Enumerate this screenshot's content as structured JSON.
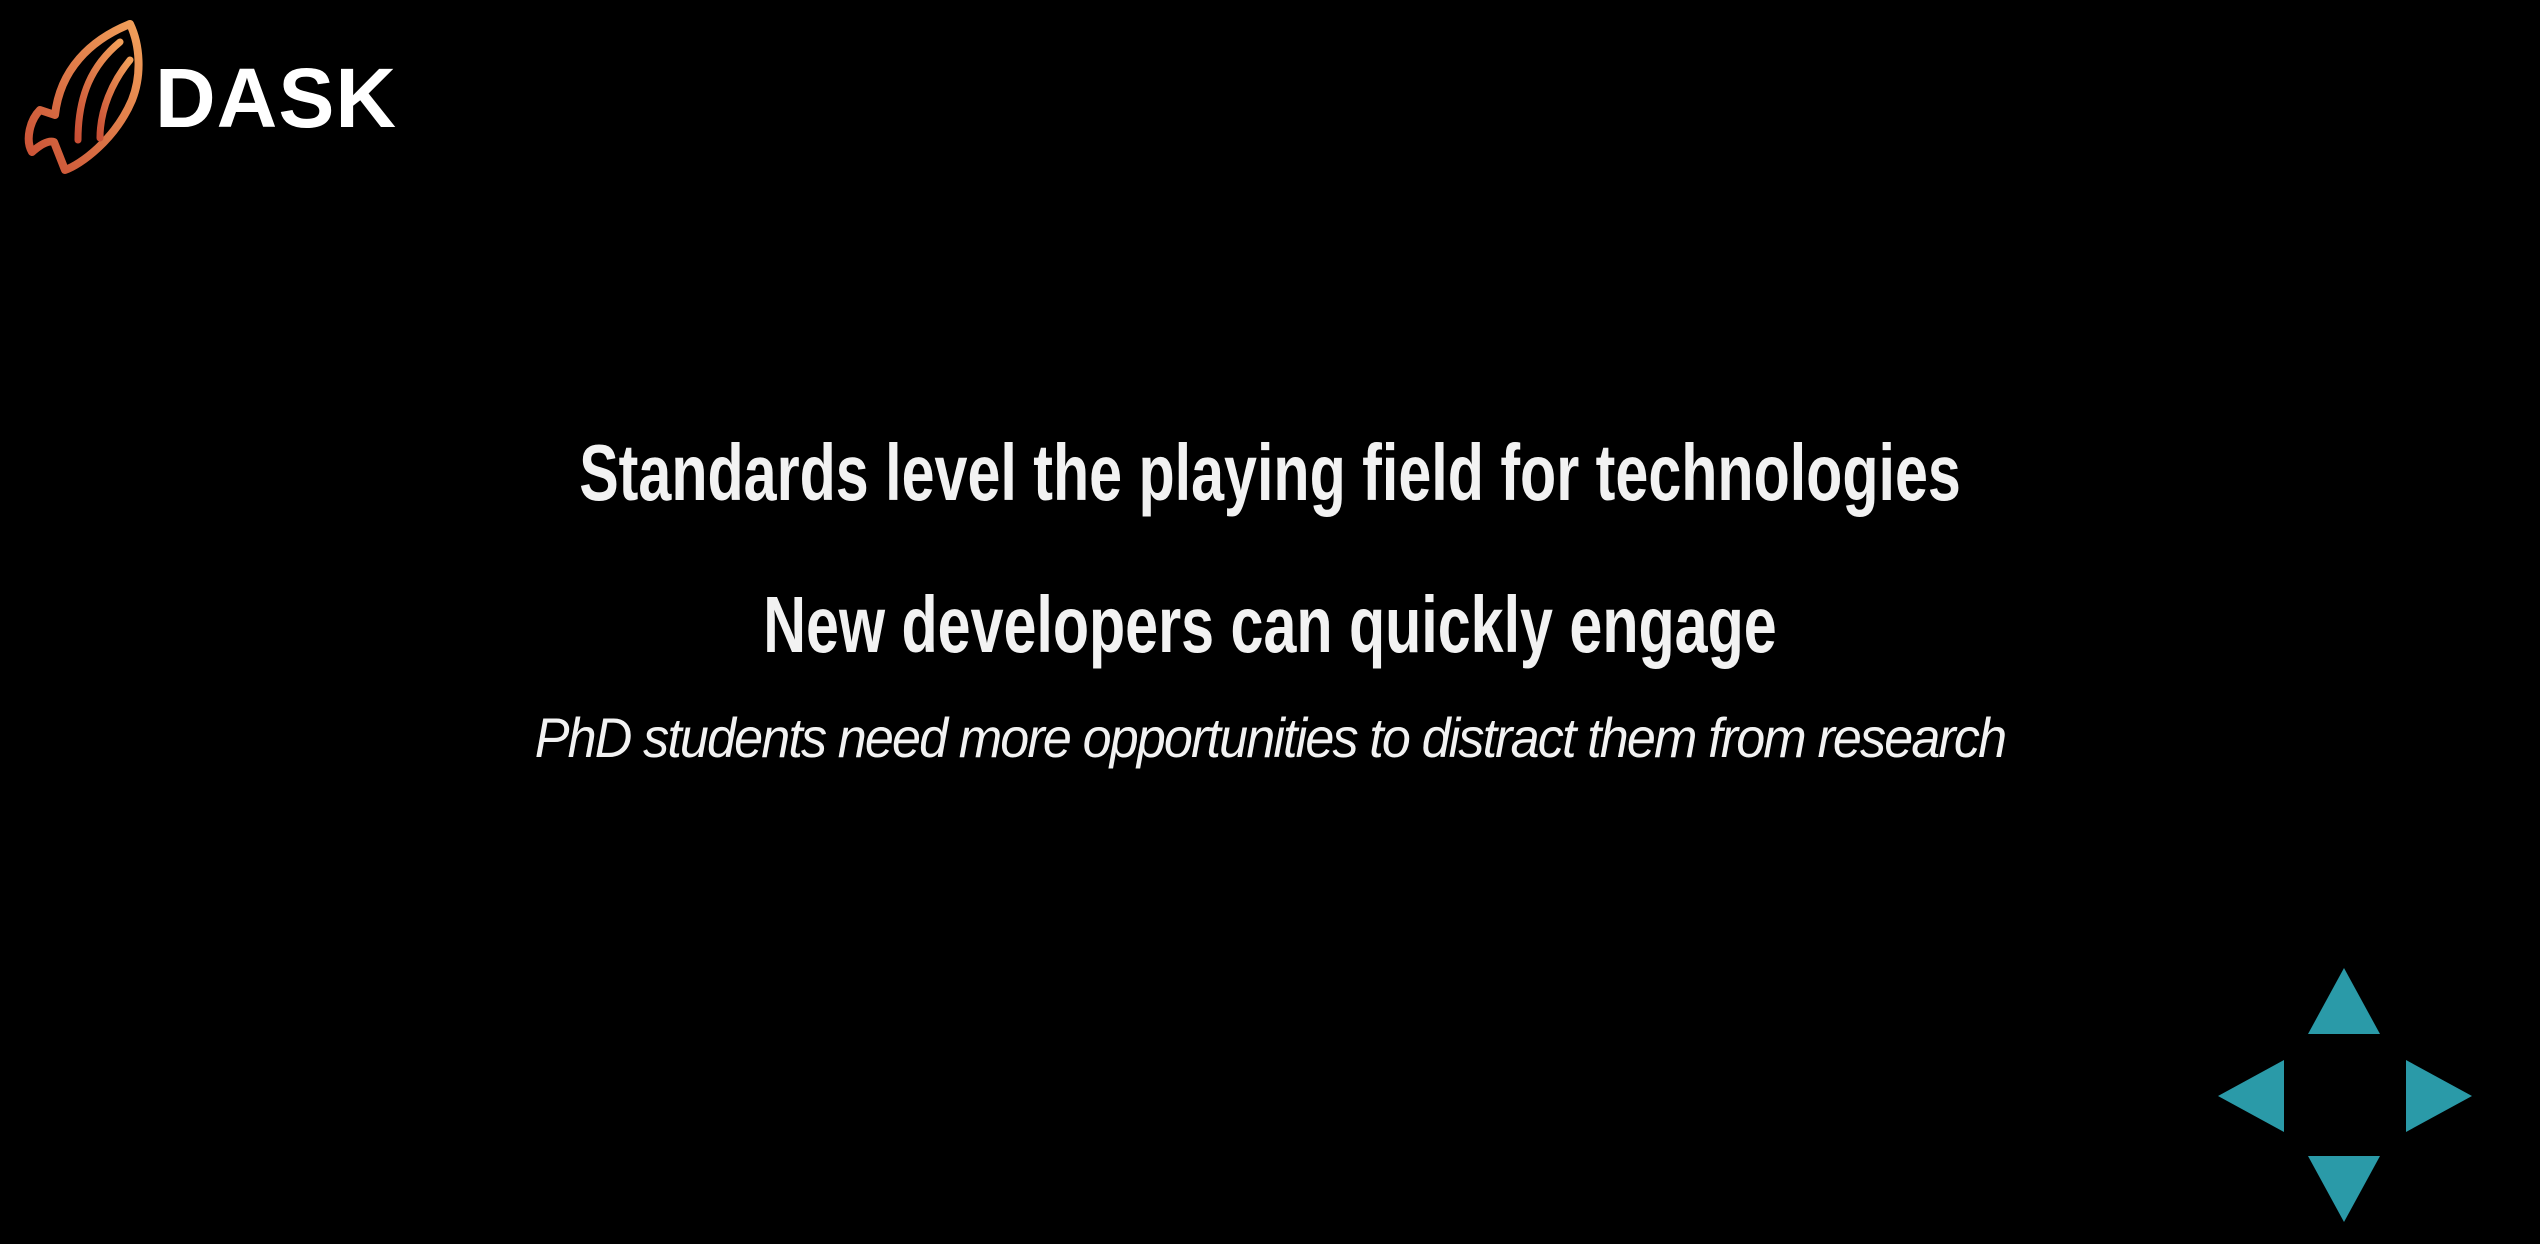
{
  "logo": {
    "text": "DASK",
    "icon": "dask-logo-icon",
    "colors": [
      "#e8804a",
      "#d65a3a",
      "#f0a060"
    ]
  },
  "slide": {
    "lines": [
      "Standards level the playing field for technologies",
      "New developers can quickly engage",
      "PhD students need more opportunities to distract them from research"
    ]
  },
  "navigation": {
    "color": "#2a9aa8",
    "controls": [
      {
        "name": "up",
        "icon": "arrow-up-icon"
      },
      {
        "name": "left",
        "icon": "arrow-left-icon"
      },
      {
        "name": "right",
        "icon": "arrow-right-icon"
      },
      {
        "name": "down",
        "icon": "arrow-down-icon"
      }
    ]
  }
}
